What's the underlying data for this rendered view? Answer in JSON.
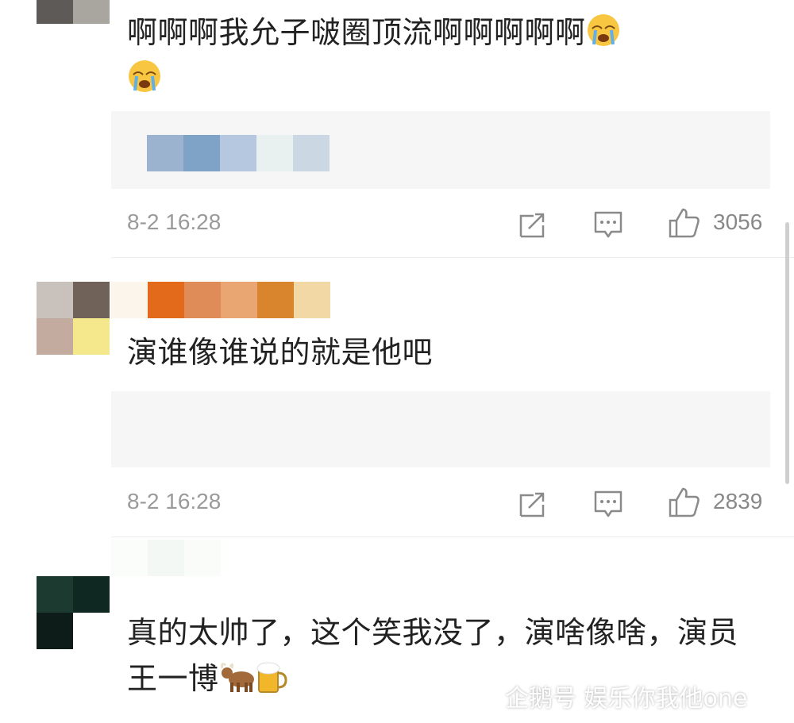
{
  "comments": [
    {
      "text": "啊啊啊我允子啵圈顶流啊啊啊啊啊",
      "emojis": [
        "crying-face",
        "crying-face"
      ],
      "time": "8-2 16:28",
      "likes": "3056"
    },
    {
      "text": "演谁像谁说的就是他吧",
      "emojis": [],
      "time": "8-2 16:28",
      "likes": "2839"
    },
    {
      "text": "真的太帅了，这个笑我没了，演啥像啥，演员王一博",
      "emojis": [
        "ox-emoji",
        "beer-mug-emoji"
      ]
    }
  ],
  "watermark": {
    "text": "企鹅号 娱乐你我他one"
  },
  "colors": {
    "time": "#9a9a9a",
    "icon": "#8a8a8a",
    "quote_bg": "#f6f6f6"
  }
}
